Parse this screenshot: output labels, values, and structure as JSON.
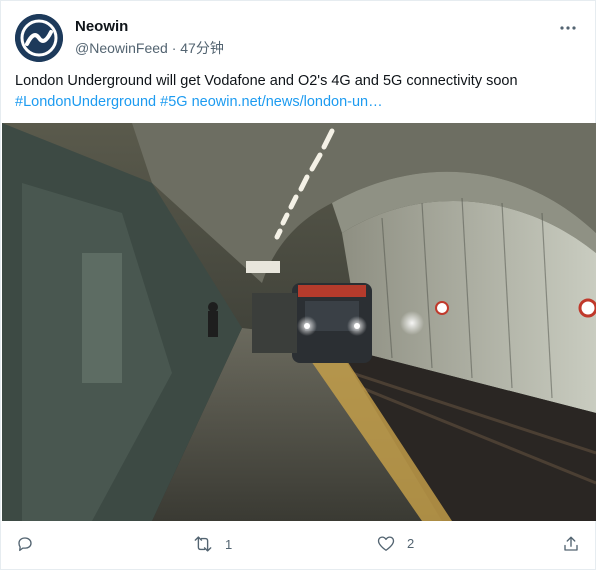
{
  "tweet": {
    "author_name": "Neowin",
    "handle": "@NeowinFeed",
    "separator": "·",
    "time": "47分钟",
    "text": "London Underground will get Vodafone and O2's 4G and 5G connectivity soon",
    "hashtag_1": "#LondonUnderground",
    "hashtag_2": "#5G",
    "link": "neowin.net/news/london-un…"
  },
  "actions": {
    "reply_count": "",
    "retweet_count": "1",
    "like_count": "2"
  },
  "colors": {
    "link": "#1d9bf0",
    "secondary_text": "#536471",
    "avatar_bg": "#1d3a5b"
  },
  "icons": [
    "neowin-logo-icon",
    "more-options-icon",
    "reply-icon",
    "retweet-icon",
    "like-icon",
    "share-icon"
  ]
}
